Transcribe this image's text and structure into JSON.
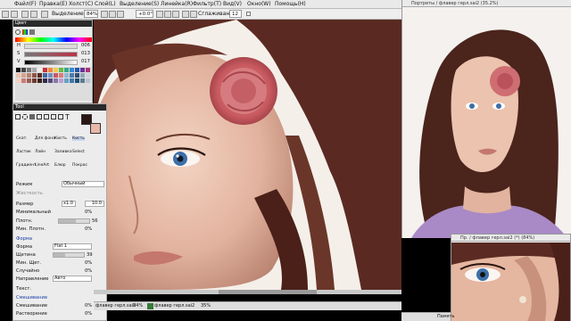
{
  "menu": [
    {
      "label": "Файл(F)"
    },
    {
      "label": "Правка(E)"
    },
    {
      "label": "Холст(C)"
    },
    {
      "label": "Слой(L)"
    },
    {
      "label": "Выделение(S)"
    },
    {
      "label": "Линейка(R)"
    },
    {
      "label": "Фильтр(T)"
    },
    {
      "label": "Вид(V)"
    },
    {
      "label": "Окно(W)"
    },
    {
      "label": "Помощь(H)"
    }
  ],
  "toolbar": {
    "selection_label": "Выделение",
    "zoom_value": "84%",
    "rotation_value": "+0.0°",
    "smoothing_label": "Сглаживание",
    "smoothing_value": "12"
  },
  "color_panel": {
    "title": "Цвет",
    "h_label": "H",
    "h_value": "006",
    "s_label": "S",
    "s_value": "013",
    "v_label": "V",
    "v_value": "017",
    "main_color": "#2a1612",
    "secondary_color": "#e9b8a9"
  },
  "tool_panel": {
    "title": "Tool",
    "brushes": [
      {
        "label": "Скат."
      },
      {
        "label": "Для фона"
      },
      {
        "label": "Кисть"
      },
      {
        "label": "Кисть"
      },
      {
        "label": "Ластик"
      },
      {
        "label": "Лайн"
      },
      {
        "label": "Заливка"
      },
      {
        "label": "Select"
      },
      {
        "label": "Градиент"
      },
      {
        "label": "LineArt"
      },
      {
        "label": "Блюр"
      },
      {
        "label": "Покрас"
      }
    ],
    "mode_label": "Режим",
    "mode_value": "Обычный",
    "hardness_label": "Жесткость",
    "size_label": "Размер",
    "size_mult": "x1.0",
    "size_value": "10.0",
    "min_size_label": "Минимальный",
    "min_size_value": "0%",
    "density_label": "Плотн.",
    "density_value": "56",
    "min_density_label": "Мин. Плотн.",
    "min_density_value": "0%",
    "form_header": "Форма",
    "form_label": "Форма",
    "form_value": "Flat 1",
    "bristle_label": "Щетина",
    "bristle_value": "39",
    "min_bristle_label": "Мин. Щет.",
    "min_bristle_value": "0%",
    "random_label": "Случайно",
    "random_value": "0%",
    "direction_label": "Направление",
    "direction_value": "Авто",
    "texture_header": "Текст.",
    "mixing_header": "Смешивание",
    "mixing_label": "Смешивание",
    "mixing_value": "0%",
    "dilution_label": "Растворение",
    "dilution_value": "0%"
  },
  "windows": {
    "ref_title": "Портреты / флавер герл.sai2 (35.2%)",
    "nav_title": "Пр. / флавер герл.sai2 (*) (84%)"
  },
  "status": {
    "doc1_name": "флавер герл.sai2",
    "doc1_zoom": "84%",
    "doc2_name": "флавер герл.sai2",
    "doc2_zoom": "35%",
    "memory_label": "Память"
  }
}
